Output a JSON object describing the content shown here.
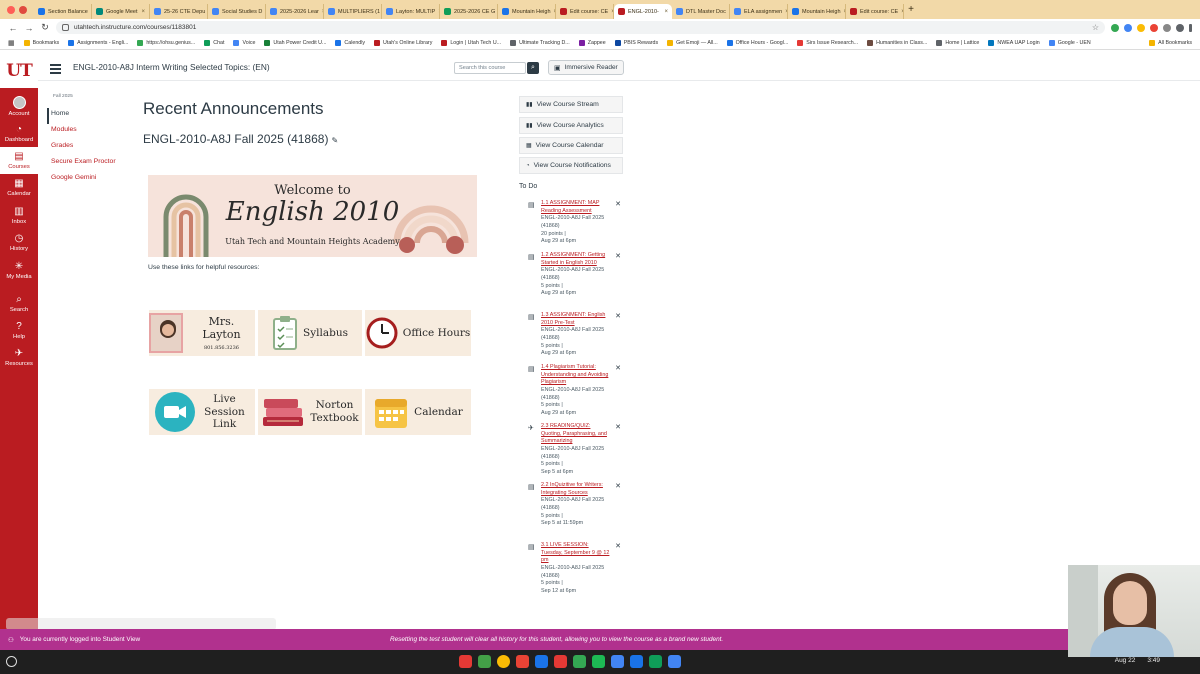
{
  "browser": {
    "tabs": [
      {
        "label": "Section Balance",
        "color": "#1a73e8"
      },
      {
        "label": "Google Meet",
        "color": "#00897b"
      },
      {
        "label": "25-26 CTE Depu",
        "color": "#4285f4"
      },
      {
        "label": "Social Studies D",
        "color": "#4285f4"
      },
      {
        "label": "2025-2026 Lear",
        "color": "#4285f4"
      },
      {
        "label": "MULTIPLIERS (1",
        "color": "#4285f4"
      },
      {
        "label": "Layton: MULTIP",
        "color": "#4285f4"
      },
      {
        "label": "2025-2026 CE G",
        "color": "#0f9d58"
      },
      {
        "label": "Mountain Heigh",
        "color": "#1a73e8"
      },
      {
        "label": "Edit course: CE",
        "color": "#ba1c21"
      },
      {
        "label": "ENGL-2010-",
        "color": "#ba1c21"
      },
      {
        "label": "DTL Master Doc",
        "color": "#4285f4"
      },
      {
        "label": "ELA assignmen",
        "color": "#4285f4"
      },
      {
        "label": "Mountain Heigh",
        "color": "#1a73e8"
      },
      {
        "label": "Edit course: CE",
        "color": "#ba1c21"
      }
    ],
    "active_tab_index": 10,
    "url": "utahtech.instructure.com/courses/1183801",
    "bookmarks": [
      "Bookmarks",
      "Assignments - Engli...",
      "https://ohsu.genius...",
      "Chat",
      "Voice",
      "Utah Power Credit U...",
      "Calendly",
      "Utah's Online Library",
      "Login | Utah Tech U...",
      "Ultimate Tracking D...",
      "Zappee",
      "PBIS Rewards",
      "Get Emoji — All...",
      "Office Hours - Googl...",
      "Sirs Issue Research...",
      "Humanities in Class...",
      "Home | Lattice",
      "NWEA UAP Login",
      "Google - UEN"
    ],
    "all_bookmarks": "All Bookmarks"
  },
  "global_nav": {
    "logo": "UT",
    "items": [
      {
        "label": "Account",
        "icon": "account-avatar-icon"
      },
      {
        "label": "Dashboard",
        "icon": "dashboard-icon",
        "glyph": "◔"
      },
      {
        "label": "Courses",
        "icon": "courses-icon",
        "glyph": "▤"
      },
      {
        "label": "Calendar",
        "icon": "calendar-icon",
        "glyph": "▦"
      },
      {
        "label": "Inbox",
        "icon": "inbox-icon",
        "glyph": "▥"
      },
      {
        "label": "History",
        "icon": "history-icon",
        "glyph": "◷"
      },
      {
        "label": "My Media",
        "icon": "my-media-icon",
        "glyph": "✳"
      },
      {
        "label": "Search",
        "icon": "search-icon",
        "glyph": "⌕"
      },
      {
        "label": "Help",
        "icon": "help-icon",
        "glyph": "?"
      },
      {
        "label": "Resources",
        "icon": "resources-icon",
        "glyph": "✈"
      }
    ]
  },
  "header": {
    "course_title": "ENGL-2010-A8J Interm Writing Selected Topics: (EN)",
    "search_placeholder": "Search this course",
    "immersive_reader": "Immersive Reader"
  },
  "course_nav": {
    "term": "Fall 2025",
    "items": [
      "Home",
      "Modules",
      "Grades",
      "Secure Exam Proctor",
      "Google Gemini"
    ],
    "active": "Home"
  },
  "main": {
    "heading": "Recent Announcements",
    "subheading": "ENGL-2010-A8J Fall 2025 (41868)",
    "banner": {
      "line1": "Welcome to",
      "line2": "English 2010",
      "line3": "Utah Tech and Mountain Heights Academy"
    },
    "helper_text": "Use these links for helpful resources:",
    "tiles_row1": [
      {
        "label": "Mrs. Layton",
        "sub": "801.856.3236"
      },
      {
        "label": "Syllabus"
      },
      {
        "label": "Office Hours"
      }
    ],
    "tiles_row2": [
      {
        "label": "Live Session Link"
      },
      {
        "label": "Norton Textbook"
      },
      {
        "label": "Calendar"
      }
    ]
  },
  "sidebar": {
    "buttons": [
      {
        "label": "View Course Stream",
        "icon": "bar-chart-icon"
      },
      {
        "label": "View Course Analytics",
        "icon": "bar-chart-icon"
      },
      {
        "label": "View Course Calendar",
        "icon": "calendar-icon"
      },
      {
        "label": "View Course Notifications",
        "icon": "bell-icon"
      }
    ],
    "todo_title": "To Do",
    "todos": [
      {
        "title": "1.1 ASSIGNMENT: MAP Reading Assessment",
        "course": "ENGL-2010-A8J Fall 2025 (41868)",
        "points": "20 points",
        "due": "Aug 29 at 6pm"
      },
      {
        "title": "1.2 ASSIGNMENT: Getting Started in English 2010",
        "course": "ENGL-2010-A8J Fall 2025 (41868)",
        "points": "5 points",
        "due": "Aug 29 at 6pm"
      },
      {
        "title": "1.3 ASSIGNMENT: English 2010 Pre-Test",
        "course": "ENGL-2010-A8J Fall 2025 (41868)",
        "points": "5 points",
        "due": "Aug 29 at 6pm"
      },
      {
        "title": "1.4 Plagiarism Tutorial: Understanding and Avoiding Plagiarism",
        "course": "ENGL-2010-A8J Fall 2025 (41868)",
        "points": "5 points",
        "due": "Aug 29 at 6pm"
      },
      {
        "title": "2.3 READING/QUIZ: Quoting, Paraphrasing, and Summarizing",
        "course": "ENGL-2010-A8J Fall 2025 (41868)",
        "points": "5 points",
        "due": "Sep 5 at 6pm"
      },
      {
        "title": "2.2 InQuizitive for Writers: Integrating Sources",
        "course": "ENGL-2010-A8J Fall 2025 (41868)",
        "points": "5 points",
        "due": "Sep 5 at 11:59pm"
      },
      {
        "title": "3.1 LIVE SESSION: Tuesday, September 9 @ 12 pm",
        "course": "ENGL-2010-A8J Fall 2025 (41868)",
        "points": "5 points",
        "due": "Sep 12 at 6pm"
      }
    ]
  },
  "student_view": {
    "left": "You are currently logged into Student View",
    "right": "Resetting the test student will clear all history for this student, allowing you to view the course as a brand new student."
  },
  "taskbar": {
    "date": "Aug 22",
    "time": "3:49",
    "apps": [
      "#e53935",
      "#43a047",
      "#fbbc05",
      "#ea4335",
      "#1a73e8",
      "#e53935",
      "#34a853",
      "#1db954",
      "#4285f4",
      "#1a73e8",
      "#0f9d58",
      "#4285f4"
    ]
  },
  "colors": {
    "brand": "#ba1c21",
    "student_banner": "#b1318e"
  }
}
